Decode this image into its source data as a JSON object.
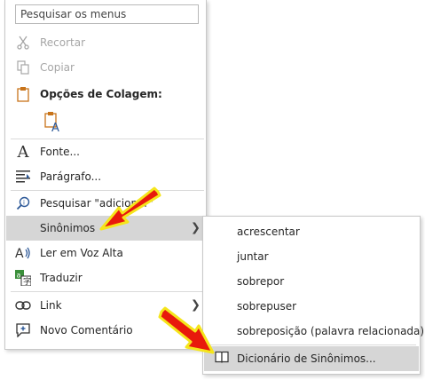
{
  "search": {
    "placeholder": "Pesquisar os menus"
  },
  "context_menu": {
    "items": [
      {
        "id": "cut",
        "label": "Recortar",
        "icon": "scissors-icon",
        "enabled": false
      },
      {
        "id": "copy",
        "label": "Copiar",
        "icon": "copy-icon",
        "enabled": false
      },
      {
        "id": "paste_hdr",
        "label": "Opções de Colagem:",
        "icon": "clipboard-icon"
      },
      {
        "id": "font",
        "label": "Fonte...",
        "icon": "font-a-icon"
      },
      {
        "id": "paragraph",
        "label": "Parágrafo...",
        "icon": "paragraph-icon"
      },
      {
        "id": "lookup",
        "label": "Pesquisar \"adicionar\"",
        "icon": "search-icon"
      },
      {
        "id": "synonyms",
        "label": "Sinônimos",
        "icon": "",
        "has_submenu": true,
        "highlighted": true
      },
      {
        "id": "read_aloud",
        "label": "Ler em Voz Alta",
        "icon": "read-aloud-icon"
      },
      {
        "id": "translate",
        "label": "Traduzir",
        "icon": "translate-icon"
      },
      {
        "id": "link",
        "label": "Link",
        "icon": "link-icon",
        "has_submenu": true
      },
      {
        "id": "comment",
        "label": "Novo Comentário",
        "icon": "comment-icon"
      }
    ]
  },
  "synonyms_submenu": {
    "items": [
      {
        "label": "acrescentar"
      },
      {
        "label": "juntar"
      },
      {
        "label": "sobrepor"
      },
      {
        "label": "sobrepuser"
      },
      {
        "label": "sobreposição (palavra relacionada)"
      }
    ],
    "thesaurus": {
      "label": "Dicionário de Sinônimos...",
      "icon": "book-icon",
      "highlighted": true
    }
  },
  "colors": {
    "hover_bg": "#d6d6d6",
    "arrow_fill": "#e8190c",
    "arrow_outline": "#f5e51b",
    "icon_blue": "#2b5797",
    "icon_orange": "#c8741a"
  }
}
